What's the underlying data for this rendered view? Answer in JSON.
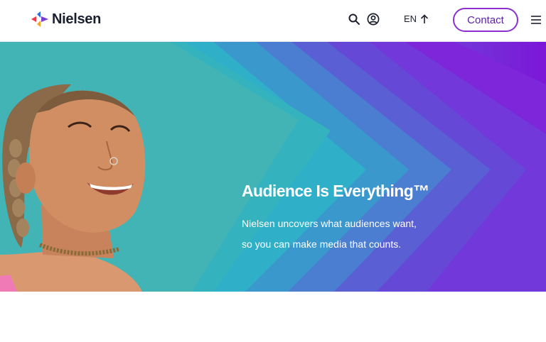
{
  "header": {
    "brand": "Nielsen",
    "logo_icon": "nielsen-triangles-logo",
    "search_icon": "search-icon",
    "account_icon": "user-account-icon",
    "language": "EN",
    "language_icon": "arrow-up-icon",
    "contact_label": "Contact",
    "menu_icon": "hamburger-menu-icon"
  },
  "hero": {
    "headline": "Audience Is Everything™",
    "subtext_line1": "Nielsen uncovers what audiences want,",
    "subtext_line2": "so you can make media that counts."
  },
  "colors": {
    "teal": "#2fb8c0",
    "purple": "#7a1ed6",
    "accent": "#8b2fd1"
  }
}
